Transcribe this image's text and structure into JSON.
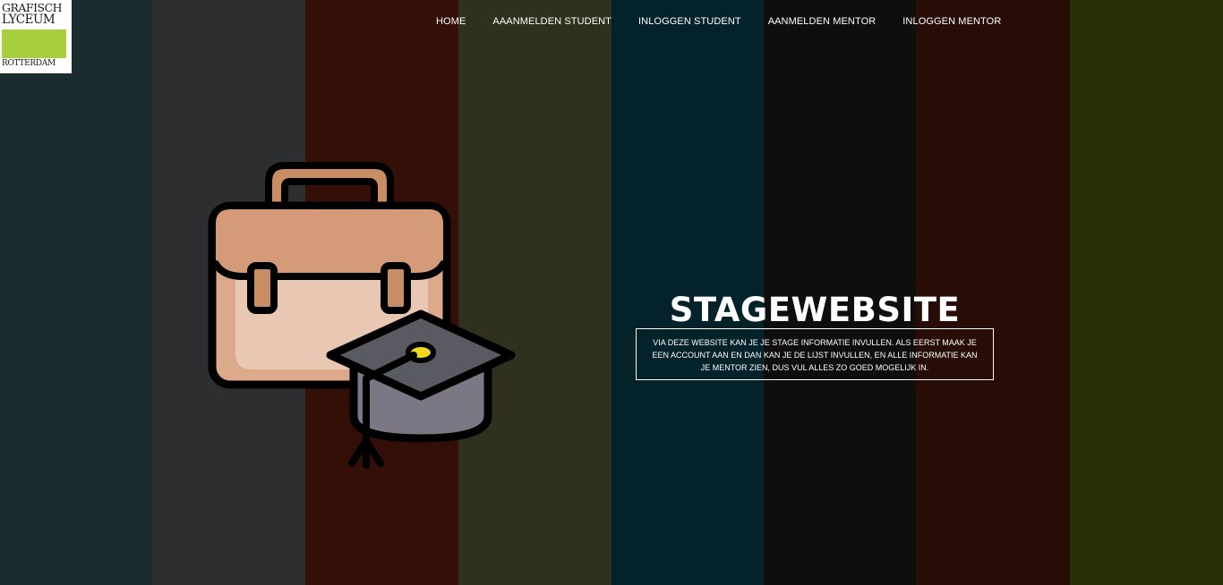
{
  "colors": {
    "stripes": [
      "#1b2c2e",
      "#2d2e30",
      "#330f08",
      "#2f311d",
      "#03222a",
      "#0f0e0d",
      "#270d06",
      "#293008"
    ],
    "logo_green": "#a7cf3b",
    "briefcase_body": "#dcaa8a",
    "briefcase_flap": "#d59a77",
    "briefcase_handle": "#c98d63",
    "cap_top": "#5a5a62",
    "cap_band": "#7c7784",
    "cap_button": "#f2d91e",
    "text": "#ffffff"
  },
  "logo": {
    "line1": "GRAFISCH",
    "line2": "LYCEUM",
    "line3": "ROTTERDAM"
  },
  "nav": {
    "items": [
      {
        "label": "HOME"
      },
      {
        "label": "AAANMELDEN STUDENT"
      },
      {
        "label": "INLOGGEN STUDENT"
      },
      {
        "label": "AANMELDEN MENTOR"
      },
      {
        "label": "INLOGGEN MENTOR"
      }
    ]
  },
  "hero": {
    "title": "STAGEWEBSITE",
    "description": "VIA DEZE WEBSITE KAN JE JE STAGE INFORMATIE INVULLEN. ALS EERST MAAK JE EEN ACCOUNT AAN EN DAN KAN JE DE LIJST INVULLEN, EN ALLE INFORMATIE KAN JE MENTOR ZIEN, DUS VUL ALLES ZO GOED MOGELIJK IN.",
    "illustration_icons": [
      "briefcase-icon",
      "graduation-cap-icon"
    ]
  }
}
